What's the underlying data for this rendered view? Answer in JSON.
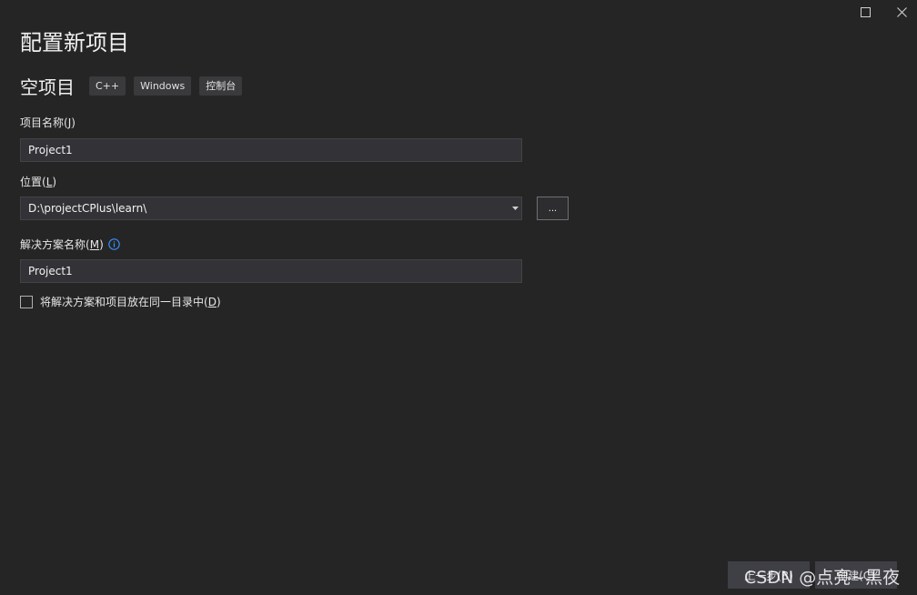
{
  "window": {
    "maximize_icon": "maximize-icon",
    "close_icon": "close-icon"
  },
  "page": {
    "title": "配置新项目"
  },
  "template": {
    "name": "空项目",
    "tags": [
      "C++",
      "Windows",
      "控制台"
    ]
  },
  "fields": {
    "project_name": {
      "label": "项目名称",
      "mnemonic_open": "(",
      "mnemonic": "J",
      "mnemonic_close": ")",
      "value": "Project1"
    },
    "location": {
      "label": "位置",
      "mnemonic_open": "(",
      "mnemonic": "L",
      "mnemonic_close": ")",
      "value": "D:\\projectCPlus\\learn\\",
      "browse_label": "..."
    },
    "solution_name": {
      "label": "解决方案名称",
      "mnemonic_open": "(",
      "mnemonic": "M",
      "mnemonic_close": ")",
      "value": "Project1",
      "info_icon": "info-icon"
    },
    "same_directory": {
      "label": "将解决方案和项目放在同一目录中",
      "mnemonic_open": "(",
      "mnemonic": "D",
      "mnemonic_close": ")",
      "checked": false
    }
  },
  "footer": {
    "back_label": "上一步(B)",
    "create_label": "创建(C)"
  },
  "watermark": {
    "text": "CSDN @点亮~黑夜"
  },
  "colors": {
    "background": "#252526",
    "input_bg": "#333337",
    "tag_bg": "#3a3a3c",
    "info_accent": "#3794ff"
  }
}
